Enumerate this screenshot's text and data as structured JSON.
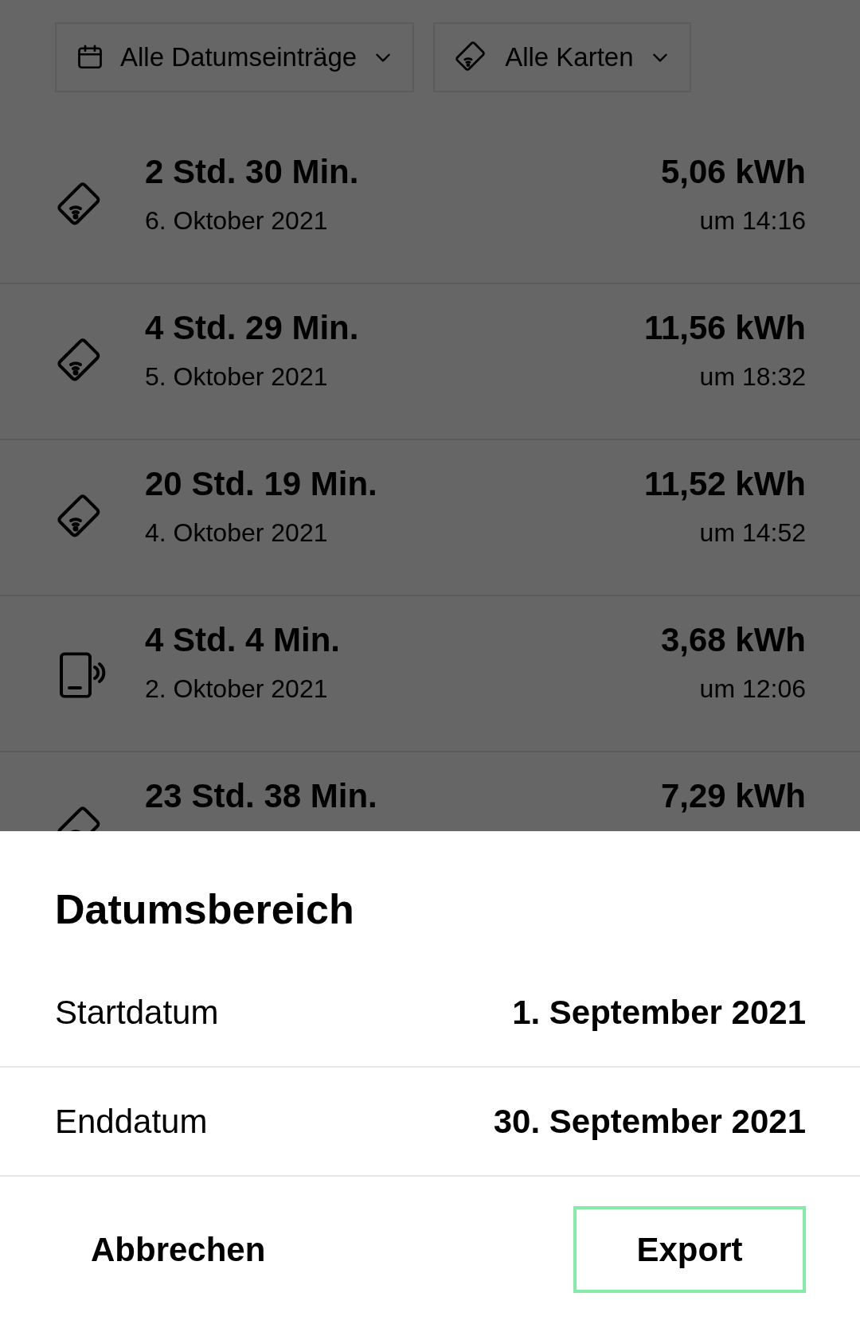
{
  "filters": [
    {
      "kind": "date",
      "label": "Alle Datumseinträge"
    },
    {
      "kind": "card",
      "label": "Alle Karten"
    }
  ],
  "sessions": [
    {
      "kind": "card",
      "duration": "2 Std. 30 Min.",
      "date": "6. Oktober 2021",
      "energy": "5,06 kWh",
      "time": "um 14:16"
    },
    {
      "kind": "card",
      "duration": "4 Std. 29 Min.",
      "date": "5. Oktober 2021",
      "energy": "11,56 kWh",
      "time": "um 18:32"
    },
    {
      "kind": "card",
      "duration": "20 Std. 19 Min.",
      "date": "4. Oktober 2021",
      "energy": "11,52 kWh",
      "time": "um 14:52"
    },
    {
      "kind": "phone",
      "duration": "4 Std. 4 Min.",
      "date": "2. Oktober 2021",
      "energy": "3,68 kWh",
      "time": "um 12:06"
    },
    {
      "kind": "card",
      "duration": "23 Std. 38 Min.",
      "energy": "7,29 kWh"
    }
  ],
  "sheet": {
    "title": "Datumsbereich",
    "fields": [
      {
        "label": "Startdatum",
        "value": "1. September 2021"
      },
      {
        "label": "Enddatum",
        "value": "30. September 2021"
      }
    ],
    "cancel": "Abbrechen",
    "confirm": "Export"
  }
}
